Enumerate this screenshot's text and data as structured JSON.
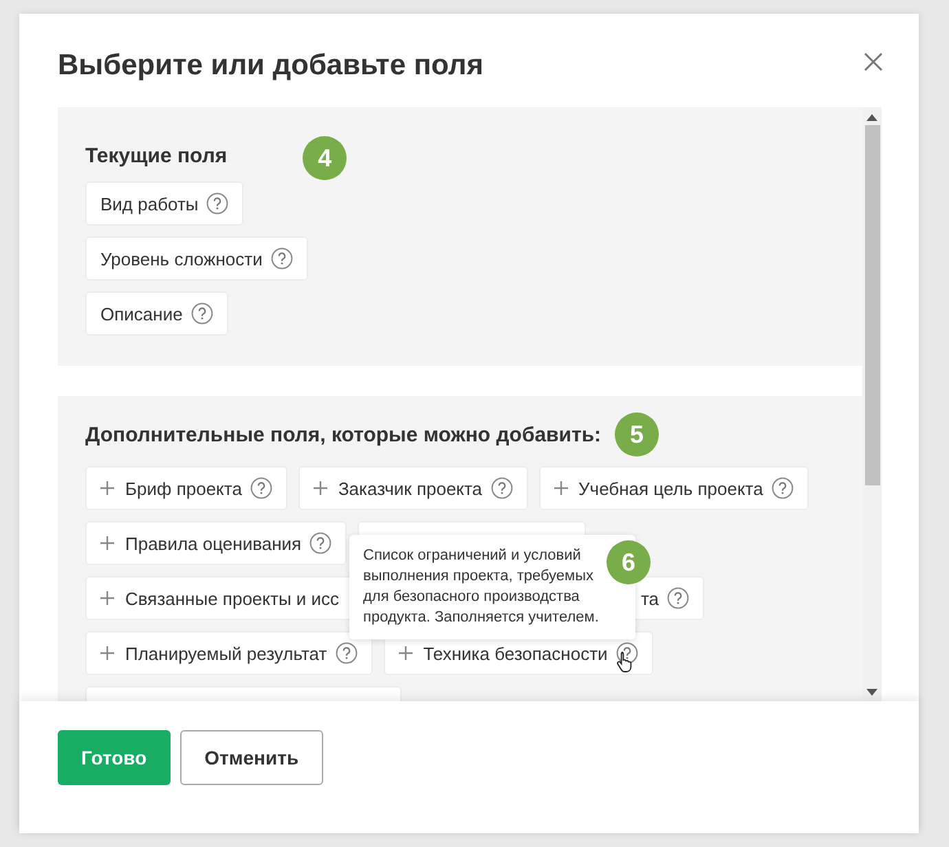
{
  "dialog": {
    "title": "Выберите или добавьте поля",
    "current": {
      "heading": "Текущие поля",
      "badge": "4",
      "fields": [
        {
          "label": "Вид работы"
        },
        {
          "label": "Уровень сложности"
        },
        {
          "label": "Описание"
        }
      ]
    },
    "additional": {
      "heading": "Дополнительные поля, которые можно добавить:",
      "badge": "5",
      "fields": [
        {
          "kind": "full",
          "label": "Бриф проекта"
        },
        {
          "kind": "full",
          "label": "Заказчик проекта"
        },
        {
          "kind": "full",
          "label": "Учебная цель проекта"
        },
        {
          "kind": "full",
          "label": "Правила оценивания"
        },
        {
          "kind": "covered"
        },
        {
          "kind": "split",
          "label": "Связанные проекты и исс",
          "label_end": "та"
        },
        {
          "kind": "full",
          "label": "Планируемый результат"
        },
        {
          "kind": "full",
          "label": "Техника безопасности",
          "hovered": true
        },
        {
          "kind": "covered"
        }
      ]
    },
    "tooltip": {
      "text": "Список ограничений и условий выполнения проекта, требуемых для безопасного производства продукта. Заполняется учителем.",
      "badge": "6"
    },
    "buttons": [
      {
        "kind": "primary",
        "label": "Готово"
      },
      {
        "kind": "secondary",
        "label": "Отменить"
      }
    ]
  }
}
